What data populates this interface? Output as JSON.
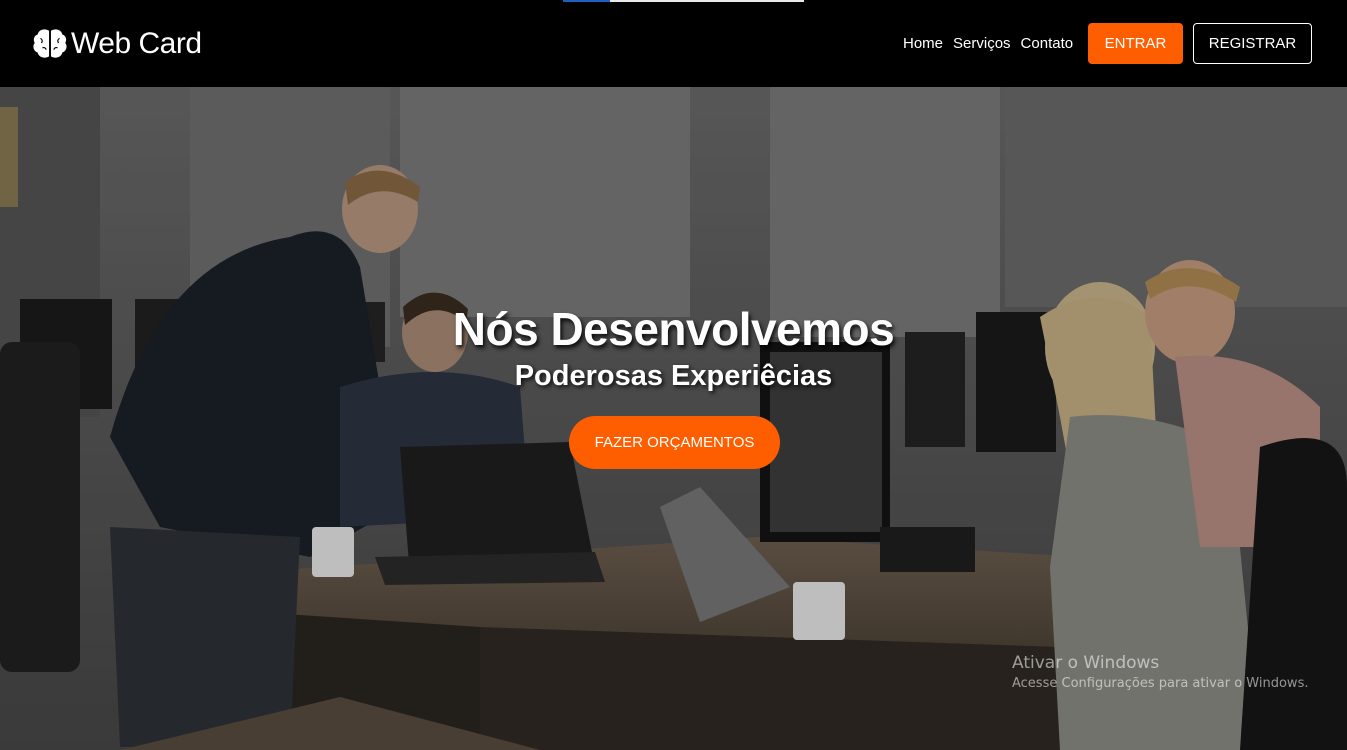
{
  "brand": {
    "name": "Web Card",
    "icon": "brain-icon"
  },
  "nav": {
    "links": [
      "Home",
      "Serviços",
      "Contato"
    ],
    "enter_label": "ENTRAR",
    "register_label": "REGISTRAR"
  },
  "hero": {
    "title": "Nós Desenvolvemos",
    "subtitle": "Poderosas Experiêcias",
    "cta_label": "FAZER ORÇAMENTOS"
  },
  "watermark": {
    "title": "Ativar o Windows",
    "subtitle": "Acesse Configurações para ativar o Windows."
  },
  "colors": {
    "accent": "#ff5e00",
    "navbar": "#000000",
    "text": "#ffffff"
  }
}
